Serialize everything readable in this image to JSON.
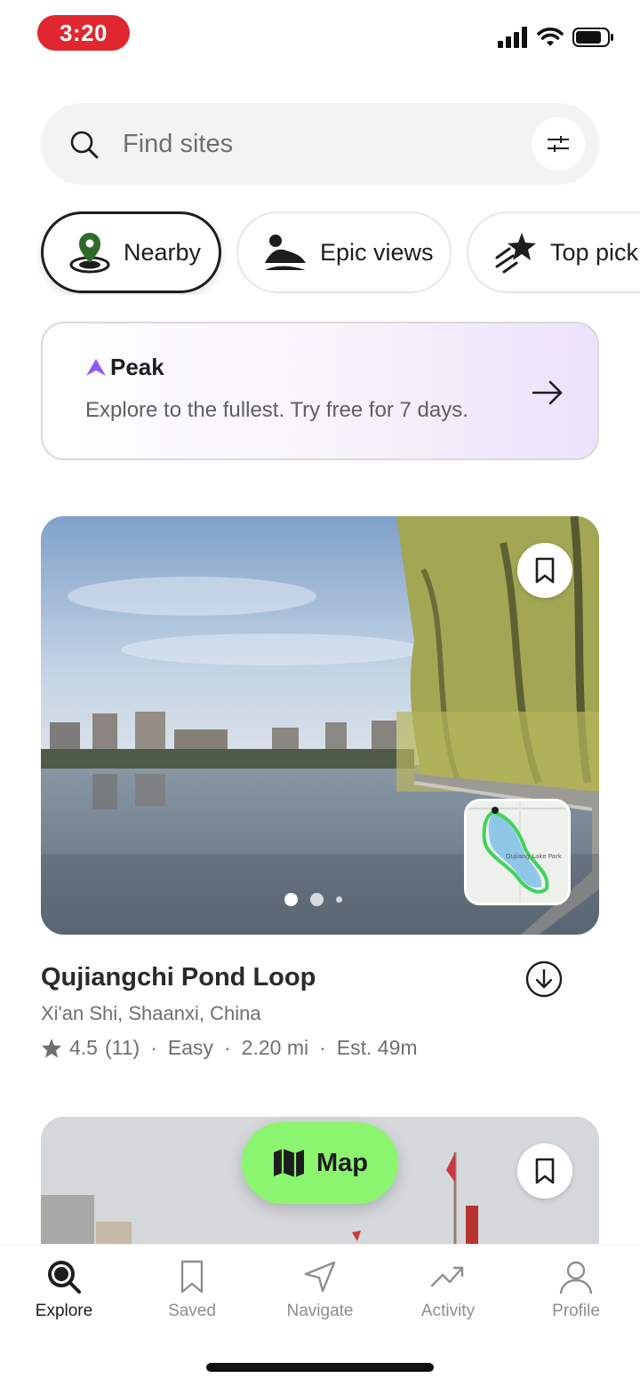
{
  "status_bar": {
    "time": "3:20"
  },
  "search": {
    "placeholder": "Find sites"
  },
  "chips": [
    {
      "label": "Nearby",
      "icon": "location-pin-icon",
      "active": true
    },
    {
      "label": "Epic views",
      "icon": "mountain-icon",
      "active": false
    },
    {
      "label": "Top pick",
      "icon": "shooting-star-icon",
      "active": false
    }
  ],
  "promo": {
    "brand": "Peak",
    "text": "Explore to the fullest. Try free for 7 days."
  },
  "trail": {
    "name": "Qujiangchi Pond Loop",
    "location": "Xi'an Shi, Shaanxi, China",
    "rating": "4.5",
    "reviews": "(11)",
    "difficulty": "Easy",
    "distance": "2.20 mi",
    "duration": "Est. 49m",
    "map_thumb_label": "Qujiang Lake Park",
    "image_pages": 3,
    "image_page_current": 1
  },
  "map_button": {
    "label": "Map"
  },
  "tabs": [
    {
      "label": "Explore",
      "icon": "explore-search-icon",
      "active": true
    },
    {
      "label": "Saved",
      "icon": "bookmark-icon",
      "active": false
    },
    {
      "label": "Navigate",
      "icon": "navigate-arrow-icon",
      "active": false
    },
    {
      "label": "Activity",
      "icon": "activity-trend-icon",
      "active": false
    },
    {
      "label": "Profile",
      "icon": "profile-icon",
      "active": false
    }
  ],
  "colors": {
    "accent_green": "#8cf56f",
    "time_pill_red": "#e0262f",
    "peak_purple": "#8b5cf6"
  }
}
